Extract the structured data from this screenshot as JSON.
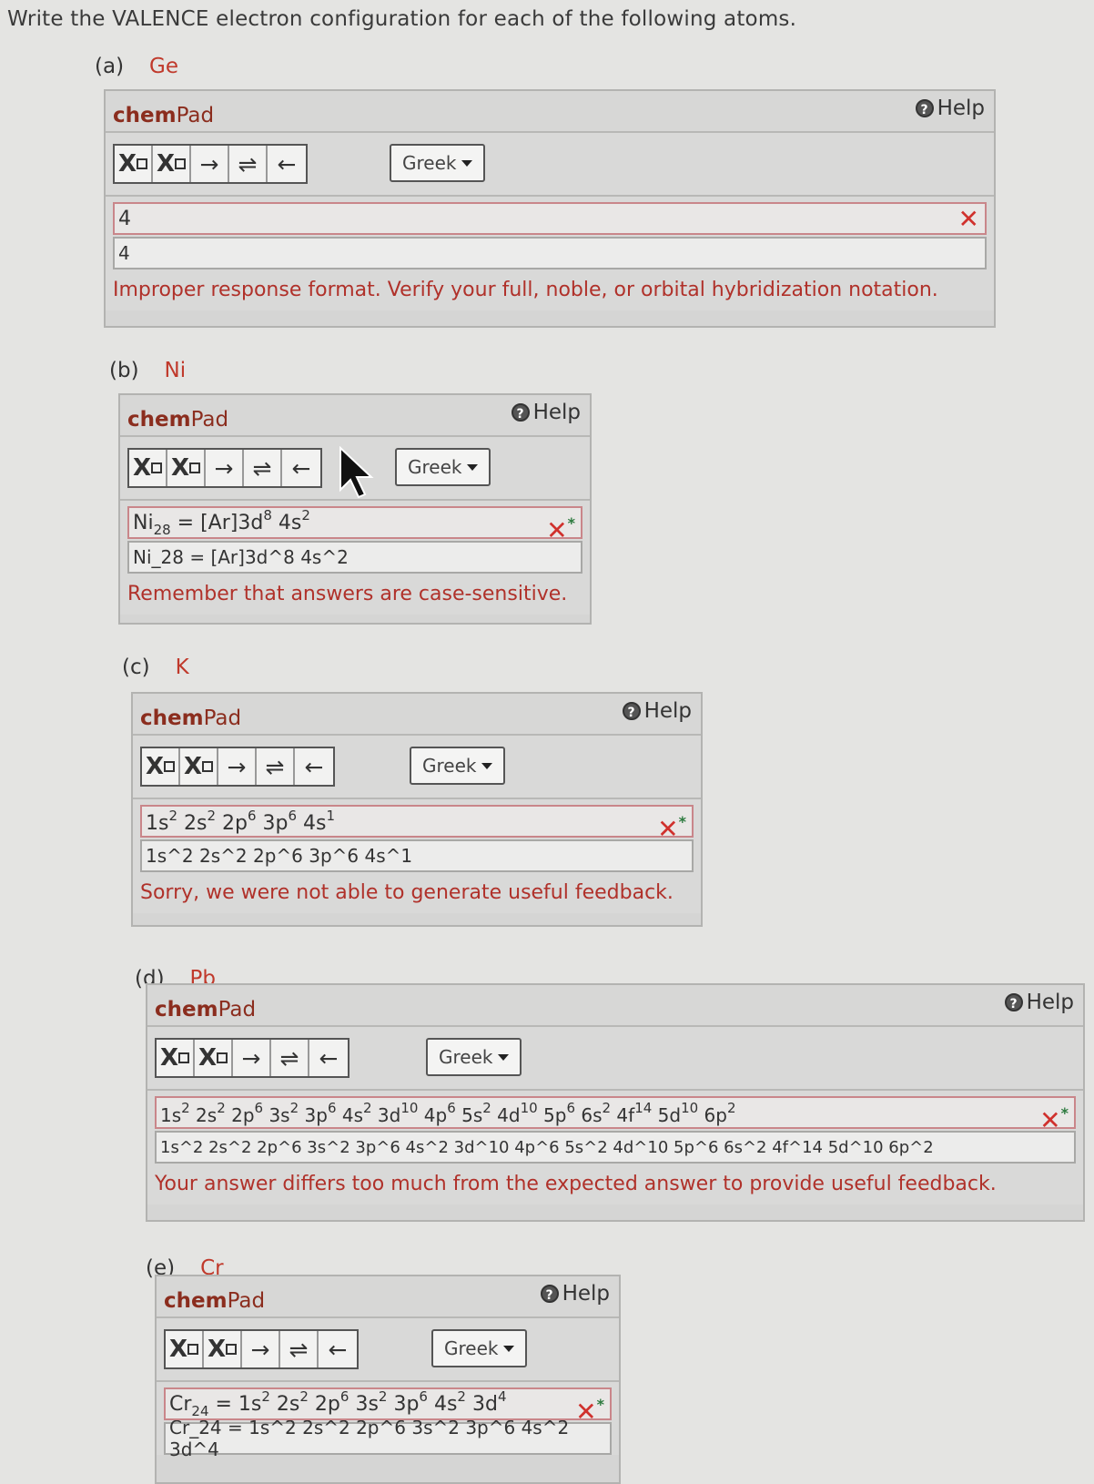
{
  "question": "Write the VALENCE electron configuration for each of the following atoms.",
  "common": {
    "pad_title_bold": "chem",
    "pad_title_rest": "Pad",
    "help_label": "Help",
    "greek_label": "Greek",
    "tool_arrow_right": "→",
    "tool_equilibrium": "⇌",
    "tool_arrow_left": "←"
  },
  "parts": [
    {
      "label": "(a)",
      "element": "Ge",
      "answer_rendered": "4",
      "answer_raw": "4",
      "feedback": "Improper response format. Verify your full, noble, or orbital hybridization notation."
    },
    {
      "label": "(b)",
      "element": "Ni",
      "answer_rendered_html": "Ni<sub>28</sub> = [Ar]3d<sup>8</sup> 4s<sup>2</sup>",
      "answer_raw": "Ni_28 = [Ar]3d^8 4s^2",
      "feedback": "Remember that answers are case-sensitive."
    },
    {
      "label": "(c)",
      "element": "K",
      "answer_rendered_html": "1s<sup>2</sup> 2s<sup>2</sup> 2p<sup>6</sup> 3p<sup>6</sup> 4s<sup>1</sup>",
      "answer_raw": "1s^2 2s^2 2p^6 3p^6 4s^1",
      "feedback": "Sorry, we were not able to generate useful feedback."
    },
    {
      "label": "(d)",
      "element": "Pb",
      "answer_rendered_html": "1s<sup>2</sup> 2s<sup>2</sup> 2p<sup>6</sup> 3s<sup>2</sup> 3p<sup>6</sup> 4s<sup>2</sup> 3d<sup>10</sup> 4p<sup>6</sup> 5s<sup>2</sup> 4d<sup>10</sup> 5p<sup>6</sup> 6s<sup>2</sup> 4f<sup>14</sup> 5d<sup>10</sup> 6p<sup>2</sup>",
      "answer_raw": "1s^2 2s^2 2p^6 3s^2 3p^6 4s^2 3d^10 4p^6 5s^2 4d^10 5p^6 6s^2 4f^14 5d^10 6p^2",
      "feedback": "Your answer differs too much from the expected answer to provide useful feedback."
    },
    {
      "label": "(e)",
      "element": "Cr",
      "answer_rendered_html": "Cr<sub>24</sub> = 1s<sup>2</sup> 2s<sup>2</sup> 2p<sup>6</sup> 3s<sup>2</sup> 3p<sup>6</sup> 4s<sup>2</sup> 3d<sup>4</sup>",
      "answer_raw": "Cr_24 = 1s^2 2s^2 2p^6 3s^2 3p^6 4s^2 3d^4"
    }
  ]
}
